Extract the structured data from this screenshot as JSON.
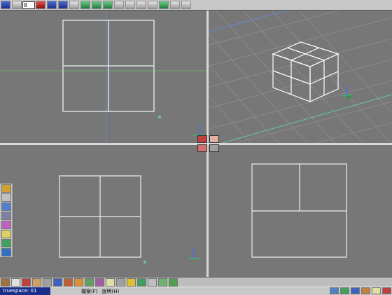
{
  "toolbar": {
    "frame_value": "0",
    "buttons": [
      "rewind-icon",
      "prev-frame-icon",
      "play-icon",
      "next-frame-icon",
      "end-icon",
      "timeline-icon",
      "grid-icon",
      "paint-icon",
      "model-icon",
      "render-icon",
      "camera-icon",
      "deform-icon",
      "light-icon",
      "align-icon",
      "magnet-icon",
      "trash-icon"
    ]
  },
  "viewports": {
    "top": "top-view",
    "perspective": "perspective-view",
    "front": "front-view",
    "side": "side-view"
  },
  "statusbar": {
    "title": "truespace: 01",
    "menu_file": "檔案(F)",
    "menu_help": "說明(H)"
  },
  "colors": {
    "viewport_bg": "#777777",
    "wire": "#e8f0f0",
    "axis_blue": "#6688cc",
    "axis_green": "#66cc99",
    "title_bar": "#1b2f8a"
  }
}
